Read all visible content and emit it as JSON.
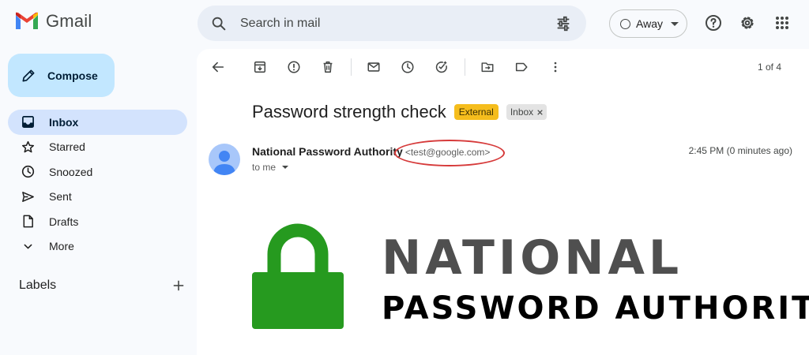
{
  "app": {
    "name": "Gmail"
  },
  "search": {
    "placeholder": "Search in mail"
  },
  "status": {
    "label": "Away"
  },
  "compose": {
    "label": "Compose"
  },
  "sidebar": {
    "items": [
      {
        "label": "Inbox",
        "icon": "inbox-icon",
        "active": true
      },
      {
        "label": "Starred",
        "icon": "star-icon"
      },
      {
        "label": "Snoozed",
        "icon": "clock-icon"
      },
      {
        "label": "Sent",
        "icon": "send-icon"
      },
      {
        "label": "Drafts",
        "icon": "draft-icon"
      },
      {
        "label": "More",
        "icon": "chevron-down-icon"
      }
    ],
    "labels_heading": "Labels"
  },
  "toolbar": {
    "pager": "1 of 4"
  },
  "message": {
    "subject": "Password strength check",
    "tags": {
      "external": "External",
      "inbox": "Inbox"
    },
    "sender_name": "National Password Authority",
    "sender_email": "<test@google.com>",
    "recipient": "to me",
    "timestamp": "2:45 PM (0 minutes ago)",
    "body": {
      "brand_line1": "NATIONAL",
      "brand_line2": "PASSWORD AUTHORITY"
    }
  },
  "colors": {
    "compose_bg": "#c2e7ff",
    "active_nav": "#d3e3fd",
    "external_tag": "#f5bd1d",
    "lock_green": "#269a1f",
    "annotation_red": "#d63a3a"
  }
}
